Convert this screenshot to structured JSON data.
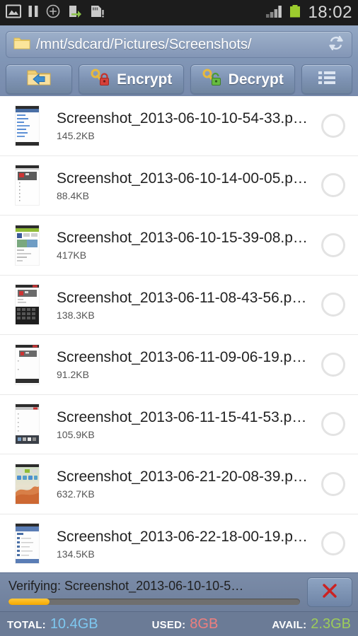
{
  "status_bar": {
    "time": "18:02",
    "icons": [
      "gallery-icon",
      "pause-icon",
      "plus-circle-icon",
      "usb-transfer-icon",
      "sdcard-alert-icon"
    ],
    "right_icons": [
      "signal-bars-icon",
      "battery-icon"
    ],
    "battery_color": "#9ccc2e",
    "background": "#1c1c1c"
  },
  "header": {
    "path": "/mnt/sdcard/Pictures/Screenshots/",
    "folder_icon": "folder-icon",
    "refresh_icon": "refresh-icon",
    "accent": "#7e93b4",
    "toolbar": {
      "back_label": "",
      "back_icon": "folder-back-icon",
      "encrypt_label": "Encrypt",
      "encrypt_icon": "key-lock-red-icon",
      "decrypt_label": "Decrypt",
      "decrypt_icon": "key-unlock-green-icon",
      "menu_icon": "list-view-icon"
    }
  },
  "files": [
    {
      "name": "Screenshot_2013-06-10-10-54-33.p…",
      "size": "145.2KB",
      "selected": false,
      "thumb": "chat-app-screenshot"
    },
    {
      "name": "Screenshot_2013-06-10-14-00-05.p…",
      "size": "88.4KB",
      "selected": false,
      "thumb": "browser-screenshot"
    },
    {
      "name": "Screenshot_2013-06-10-15-39-08.p…",
      "size": "417KB",
      "selected": false,
      "thumb": "facebook-screenshot"
    },
    {
      "name": "Screenshot_2013-06-11-08-43-56.p…",
      "size": "138.3KB",
      "selected": false,
      "thumb": "keyboard-screenshot"
    },
    {
      "name": "Screenshot_2013-06-11-09-06-19.p…",
      "size": "91.2KB",
      "selected": false,
      "thumb": "form-screenshot"
    },
    {
      "name": "Screenshot_2013-06-11-15-41-53.p…",
      "size": "105.9KB",
      "selected": false,
      "thumb": "list-screenshot"
    },
    {
      "name": "Screenshot_2013-06-21-20-08-39.p…",
      "size": "632.7KB",
      "selected": false,
      "thumb": "homescreen-screenshot"
    },
    {
      "name": "Screenshot_2013-06-22-18-00-19.p…",
      "size": "134.5KB",
      "selected": false,
      "thumb": "filemanager-screenshot"
    }
  ],
  "progress": {
    "text": "Verifying: Screenshot_2013-06-10-10-5…",
    "percent": 14,
    "fill_color": "#f5a800",
    "cancel_icon": "close-x-icon",
    "cancel_color": "#cc2222"
  },
  "storage": {
    "total_label": "TOTAL:",
    "total_value": "10.4GB",
    "total_color": "#7ec8f0",
    "used_label": "USED:",
    "used_value": "8GB",
    "used_color": "#ef7f7f",
    "avail_label": "AVAIL:",
    "avail_value": "2.3GB",
    "avail_color": "#9ccc5a"
  }
}
